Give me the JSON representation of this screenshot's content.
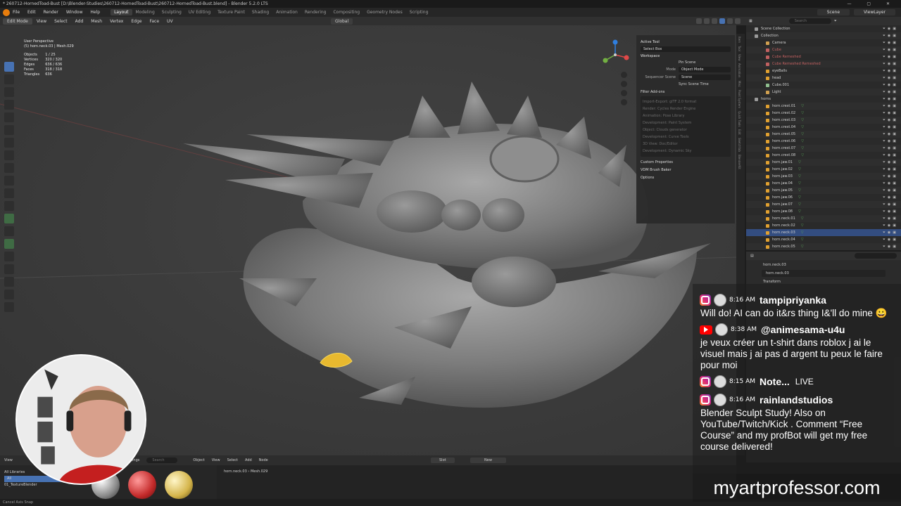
{
  "window": {
    "title": "* 260712-HornedToad-Bust [D:\\Blender-Studies\\260712-HornedToad-Bust\\260712-HornedToad-Bust.blend] - Blender 5.2.0 LTS"
  },
  "topbar": {
    "menu": [
      "File",
      "Edit",
      "Render",
      "Window",
      "Help"
    ],
    "workspaces": [
      "Layout",
      "Modeling",
      "Sculpting",
      "UV Editing",
      "Texture Paint",
      "Shading",
      "Animation",
      "Rendering",
      "Compositing",
      "Geometry Nodes",
      "Scripting"
    ],
    "active_workspace": "Layout",
    "scene": "Scene",
    "view_layer": "ViewLayer"
  },
  "viewport_header": {
    "mode": "Edit Mode",
    "menus": [
      "View",
      "Select",
      "Add",
      "Mesh",
      "Vertex",
      "Edge",
      "Face",
      "UV"
    ],
    "orientation": "Global",
    "options_label": "Options"
  },
  "viewport_overlay": {
    "perspective": "User Perspective",
    "object": "(5) horn.neck.03 | Mesh.029",
    "stats": [
      {
        "label": "Objects",
        "value": "1 / 25"
      },
      {
        "label": "Vertices",
        "value": "320 / 320"
      },
      {
        "label": "Edges",
        "value": "636 / 636"
      },
      {
        "label": "Faces",
        "value": "318 / 318"
      },
      {
        "label": "Triangles",
        "value": "636"
      }
    ]
  },
  "npanel": {
    "active_tool_header": "Active Tool",
    "tool": "Select Box",
    "workspace_header": "Workspace",
    "pin_scene": "Pin Scene",
    "mode_label": "Mode",
    "mode_value": "Object Mode",
    "sequencer_label": "Sequencer Scene",
    "sequencer_value": "Scene",
    "sync_label": "Sync Scene Time",
    "filter_addons": "Filter Add-ons",
    "addons": [
      "Import-Export: glTF 2.0 format",
      "Render: Cycles Render Engine",
      "Animation: Pose Library",
      "Development: Paint System",
      "Object: Clouds generator",
      "Development: Curve Tools",
      "3D View: Doc/Editor",
      "Development: Dynamic Sky"
    ],
    "custom_properties": "Custom Properties",
    "vdm": "VDM Brush Baker",
    "options": "Options"
  },
  "sidetabs": [
    "Item",
    "Tool",
    "View",
    "Animation",
    "Misc",
    "Paint System",
    "Quick Tools",
    "Edit",
    "Sketchfab",
    "BlenderKit"
  ],
  "outliner": {
    "search_placeholder": "Search",
    "items": [
      {
        "name": "Scene Collection",
        "color": "#9a9a9a",
        "dim": false
      },
      {
        "name": "Collection",
        "color": "#9a9a9a",
        "dim": false
      },
      {
        "name": "Camera",
        "color": "#d0a050",
        "dim": false
      },
      {
        "name": "Cube",
        "color": "#c06060",
        "dim": true
      },
      {
        "name": "Cube Remeshed",
        "color": "#c06060",
        "dim": true
      },
      {
        "name": "Cube Remeshed Remeshed",
        "color": "#c06060",
        "dim": true
      },
      {
        "name": "eyeBalls",
        "color": "#e0a030",
        "dim": false
      },
      {
        "name": "head",
        "color": "#e0a030",
        "dim": false
      },
      {
        "name": "Cube.001",
        "color": "#8fbf8f",
        "dim": false
      },
      {
        "name": "Light",
        "color": "#d0a050",
        "dim": false
      },
      {
        "name": "horns",
        "color": "#9a9a9a",
        "dim": false
      },
      {
        "name": "horn.crest.01",
        "color": "#e0a030",
        "dim": false
      },
      {
        "name": "horn.crest.02",
        "color": "#e0a030",
        "dim": false
      },
      {
        "name": "horn.crest.03",
        "color": "#e0a030",
        "dim": false
      },
      {
        "name": "horn.crest.04",
        "color": "#e0a030",
        "dim": false
      },
      {
        "name": "horn.crest.05",
        "color": "#e0a030",
        "dim": false
      },
      {
        "name": "horn.crest.06",
        "color": "#e0a030",
        "dim": false
      },
      {
        "name": "horn.crest.07",
        "color": "#e0a030",
        "dim": false
      },
      {
        "name": "horn.crest.08",
        "color": "#e0a030",
        "dim": false
      },
      {
        "name": "horn.jaw.01",
        "color": "#e0a030",
        "dim": false
      },
      {
        "name": "horn.jaw.02",
        "color": "#e0a030",
        "dim": false
      },
      {
        "name": "horn.jaw.03",
        "color": "#e0a030",
        "dim": false
      },
      {
        "name": "horn.jaw.04",
        "color": "#e0a030",
        "dim": false
      },
      {
        "name": "horn.jaw.05",
        "color": "#e0a030",
        "dim": false
      },
      {
        "name": "horn.jaw.06",
        "color": "#e0a030",
        "dim": false
      },
      {
        "name": "horn.jaw.07",
        "color": "#e0a030",
        "dim": false
      },
      {
        "name": "horn.jaw.08",
        "color": "#e0a030",
        "dim": false
      },
      {
        "name": "horn.neck.01",
        "color": "#e0a030",
        "dim": false
      },
      {
        "name": "horn.neck.02",
        "color": "#e0a030",
        "dim": false
      },
      {
        "name": "horn.neck.03",
        "color": "#e0a030",
        "dim": false,
        "selected": true
      },
      {
        "name": "horn.neck.04",
        "color": "#e0a030",
        "dim": false
      },
      {
        "name": "horn.neck.05",
        "color": "#e0a030",
        "dim": false
      }
    ]
  },
  "properties": {
    "object_name": "horn.neck.03",
    "field_name": "horn.neck.03",
    "transform_header": "Transform"
  },
  "bottom": {
    "editor_menus": [
      "View"
    ],
    "library": "All Libraries",
    "category_all": "All",
    "category_item": "01_TextureBlender",
    "shader_menus": [
      "Object",
      "View",
      "Select",
      "Add",
      "Node"
    ],
    "slot": "Slot",
    "new": "New",
    "breadcrumb_object": "horn.neck.03",
    "breadcrumb_mesh": "Mesh.029",
    "settings": "Settings",
    "search_placeholder": "Search"
  },
  "statusbar": {
    "text": "Cancel     Axis Snap"
  },
  "chat": {
    "messages": [
      {
        "platform": "instagram",
        "time": "8:16 AM",
        "user": "tampipriyanka",
        "text": "Will do! AI can do it&rs thing I&'ll do mine 😀",
        "live": ""
      },
      {
        "platform": "youtube",
        "time": "8:38 AM",
        "user": "@animesama-u4u",
        "text": "je veux créer un t-shirt dans roblox j ai le visuel mais j ai pas d argent tu peux le faire pour moi",
        "live": ""
      },
      {
        "platform": "instagram",
        "time": "8:15 AM",
        "user": "Note...",
        "text": "",
        "live": "LIVE"
      },
      {
        "platform": "instagram",
        "time": "8:16 AM",
        "user": "rainlandstudios",
        "text": "Blender Sculpt Study! Also on YouTube/Twitch/Kick . Comment “Free Course” and my profBot will get my free course delivered!",
        "live": ""
      }
    ]
  },
  "brand": {
    "text": "myartprofessor.com"
  },
  "colors": {
    "accent": "#4772b3",
    "blender_orange": "#e87d0d",
    "selection_row": "#334d80"
  }
}
